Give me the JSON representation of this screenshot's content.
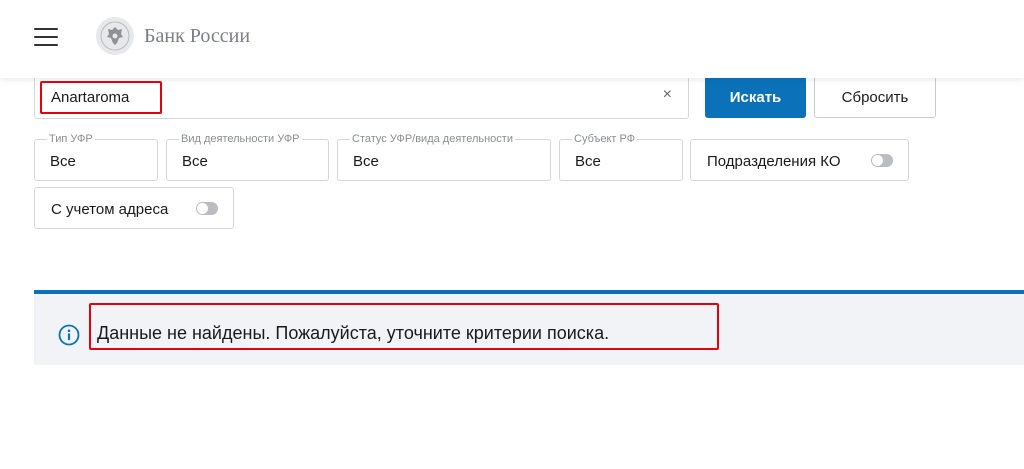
{
  "header": {
    "brand_name": "Банк России",
    "menu_icon": "hamburger-menu-icon",
    "logo_icon": "bank-emblem-icon"
  },
  "search": {
    "value": "Anartaroma",
    "clear_icon": "clear-x-icon",
    "search_button": "Искать",
    "reset_button": "Сбросить"
  },
  "filters": {
    "type_label": "Тип УФР",
    "type_value": "Все",
    "activity_label": "Вид деятельности УФР",
    "activity_value": "Все",
    "status_label": "Статус УФР/вида деятельности",
    "status_value": "Все",
    "subject_label": "Субъект РФ",
    "subject_value": "Все",
    "divisions_label": "Подразделения КО",
    "divisions_on": false,
    "address_label": "С учетом адреса",
    "address_on": false
  },
  "message": {
    "icon": "info-icon",
    "text": "Данные не найдены. Пожалуйста, уточните критерии поиска."
  },
  "colors": {
    "primary": "#0b72b9",
    "highlight": "#e3000f",
    "info_background": "#f1f3f6"
  }
}
